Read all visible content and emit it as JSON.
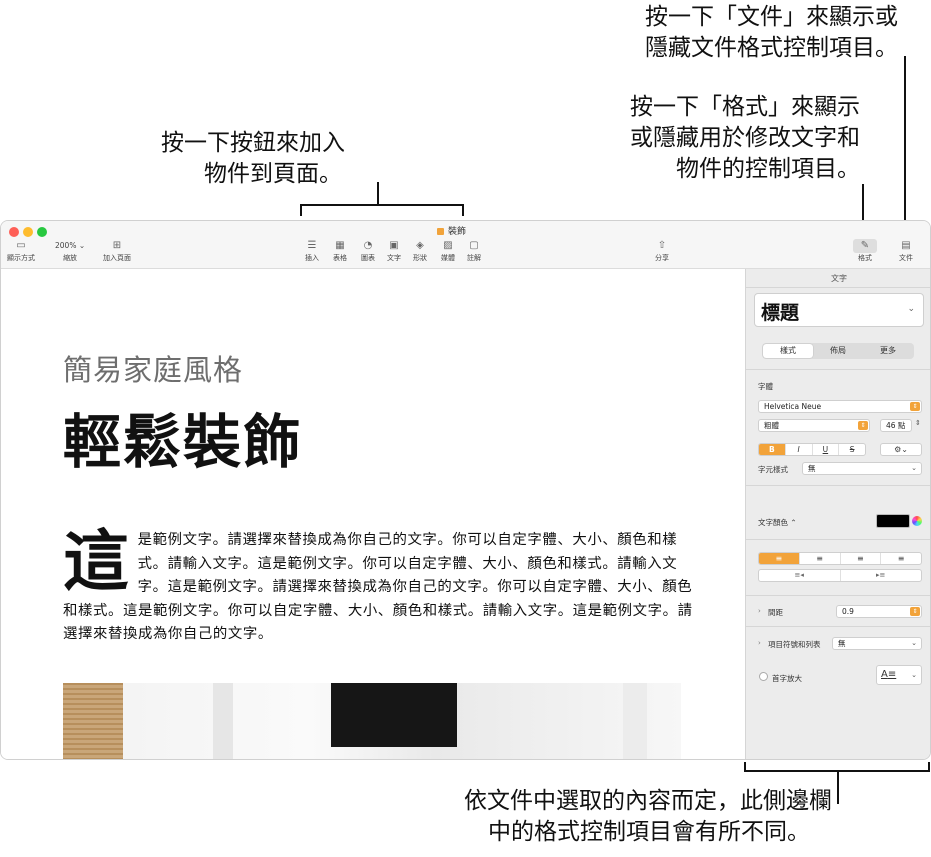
{
  "callouts": {
    "add_objects": [
      "按一下按鈕來加入",
      "物件到頁面。"
    ],
    "document": [
      "按一下「文件」來顯示或",
      "隱藏文件格式控制項目。"
    ],
    "format": [
      "按一下「格式」來顯示",
      "或隱藏用於修改文字和",
      "物件的控制項目。"
    ],
    "sidebar": [
      "依文件中選取的內容而定，此側邊欄",
      "中的格式控制項目會有所不同。"
    ]
  },
  "window": {
    "title": "裝飾",
    "toolbar": {
      "view": "顯示方式",
      "zoom_value": "200%",
      "zoom": "縮放",
      "add_page": "加入頁面",
      "insert": "插入",
      "table": "表格",
      "chart": "圖表",
      "text": "文字",
      "shape": "形狀",
      "media": "媒體",
      "comment": "註解",
      "share": "分享",
      "format": "格式",
      "document": "文件"
    }
  },
  "document": {
    "subtitle": "簡易家庭風格",
    "heading": "輕鬆裝飾",
    "dropcap": "這",
    "body": "是範例文字。請選擇來替換成為你自己的文字。你可以自定字體、大小、顏色和樣式。請輸入文字。這是範例文字。你可以自定字體、大小、顏色和樣式。請輸入文字。這是範例文字。請選擇來替換成為你自己的文字。你可以自定字體、大小、顏色和樣式。這是範例文字。你可以自定字體、大小、顏色和樣式。請輸入文字。這是範例文字。請選擇來替換成為你自己的文字。"
  },
  "sidebar": {
    "heading": "文字",
    "paragraph_style": "標題",
    "tabs": [
      "樣式",
      "佈局",
      "更多"
    ],
    "font_label": "字體",
    "font_family": "Helvetica Neue",
    "font_weight": "粗體",
    "font_size": "46 點",
    "bius": [
      "B",
      "I",
      "U",
      "S"
    ],
    "char_style_label": "字元樣式",
    "char_style_value": "無",
    "text_color_label": "文字顏色",
    "text_color": "#000000",
    "spacing_label": "間距",
    "spacing_value": "0.9",
    "bullets_label": "項目符號和列表",
    "bullets_value": "無",
    "dropcap_label": "首字放大",
    "dropcap_icon": "A"
  },
  "colors": {
    "accent": "#f2a33a"
  }
}
